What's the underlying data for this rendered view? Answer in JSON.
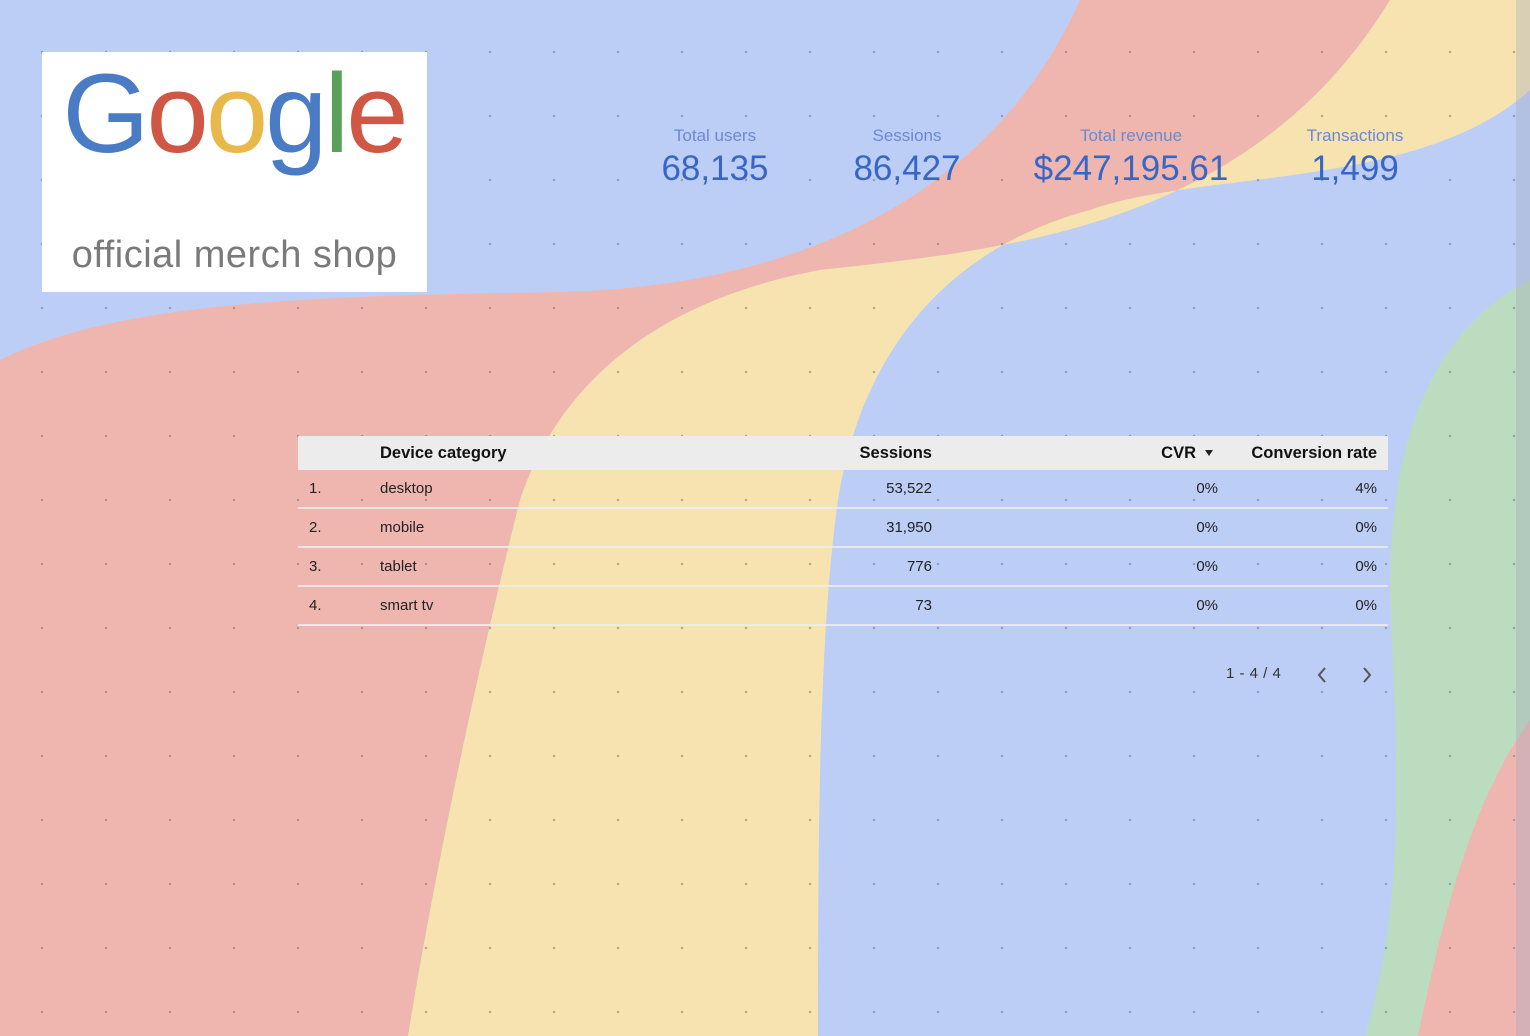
{
  "logo": {
    "wordmark": "Google",
    "subtitle": "official merch shop",
    "letter_colors": [
      "#4a7cc6",
      "#cf5743",
      "#e8b84a",
      "#4a7cc6",
      "#5aa05a",
      "#cf5743"
    ]
  },
  "kpis": [
    {
      "label": "Total users",
      "value": "68,135"
    },
    {
      "label": "Sessions",
      "value": "86,427"
    },
    {
      "label": "Total revenue",
      "value": "$247,195.61"
    },
    {
      "label": "Transactions",
      "value": "1,499"
    }
  ],
  "table": {
    "columns": {
      "device": "Device category",
      "sessions": "Sessions",
      "cvr": "CVR",
      "conversion_rate": "Conversion rate"
    },
    "sort_icon": "sort-descending-icon",
    "rows": [
      {
        "index": "1.",
        "device": "desktop",
        "sessions": "53,522",
        "cvr": "0%",
        "conversion_rate": "4%"
      },
      {
        "index": "2.",
        "device": "mobile",
        "sessions": "31,950",
        "cvr": "0%",
        "conversion_rate": "0%"
      },
      {
        "index": "3.",
        "device": "tablet",
        "sessions": "776",
        "cvr": "0%",
        "conversion_rate": "0%"
      },
      {
        "index": "4.",
        "device": "smart tv",
        "sessions": "73",
        "cvr": "0%",
        "conversion_rate": "0%"
      }
    ]
  },
  "pagination": {
    "range": "1 - 4 / 4",
    "prev_icon": "chevron-left-icon",
    "next_icon": "chevron-right-icon"
  },
  "colors": {
    "background_blue": "#bccef6",
    "background_red": "#efb6b0",
    "background_yellow": "#f7e3b0",
    "background_green": "#bcdcbf",
    "kpi_value": "#3866c4",
    "kpi_label": "#6a8ad0"
  }
}
